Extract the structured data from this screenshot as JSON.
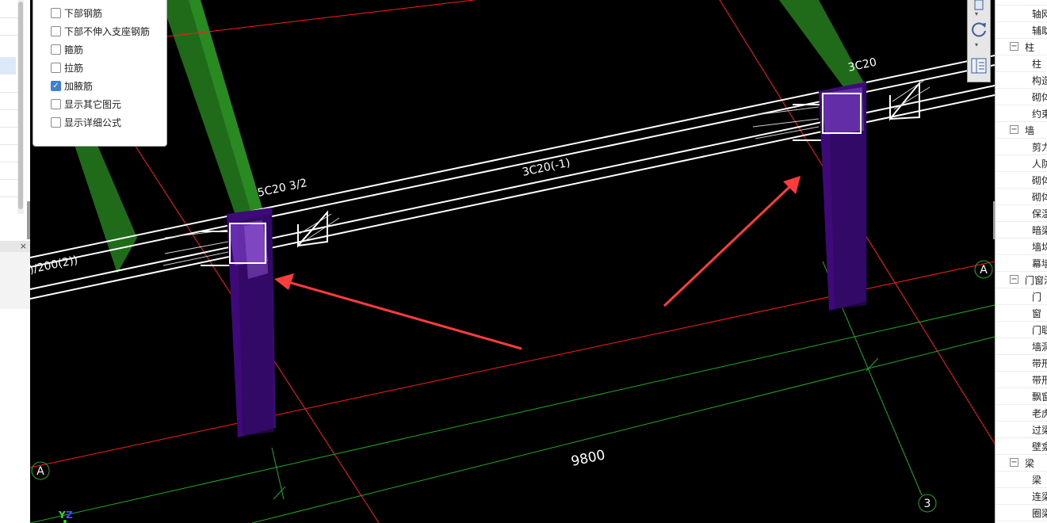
{
  "left_panel": {
    "header_label": "×"
  },
  "popup": {
    "options": [
      {
        "label": "下部钢筋",
        "checked": false
      },
      {
        "label": "下部不伸入支座钢筋",
        "checked": false
      },
      {
        "label": "箍筋",
        "checked": false
      },
      {
        "label": "拉筋",
        "checked": false
      },
      {
        "label": "加腋筋",
        "checked": true
      },
      {
        "label": "显示其它图元",
        "checked": false
      },
      {
        "label": "显示详细公式",
        "checked": false
      }
    ]
  },
  "viewport": {
    "annotations": {
      "beam_left": ")/200(2))",
      "left_column_top": "5C20 3/2",
      "beam_mid": "3C20(-1)",
      "right_column_top": "3C20",
      "dimension": "9800",
      "axis_a_left": "A",
      "axis_a_right": "A",
      "axis_3": "3",
      "coord_y": "Y",
      "coord_z": "Z"
    },
    "colors": {
      "background": "#000000",
      "column": "#3d0a78",
      "column_face": "#5a1eb0",
      "green_beam": "#1f6b1a",
      "red_axis": "#ff1a1a",
      "green_axis": "#1faa1f",
      "arrow": "#ff3b3b"
    }
  },
  "right_panel": {
    "rows": [
      {
        "type": "item",
        "label": "轴网"
      },
      {
        "type": "item",
        "label": "辅助"
      },
      {
        "type": "group",
        "label": "柱",
        "toggle": "−"
      },
      {
        "type": "item",
        "label": "柱"
      },
      {
        "type": "item",
        "label": "构造"
      },
      {
        "type": "item",
        "label": "砌体"
      },
      {
        "type": "item",
        "label": "约束"
      },
      {
        "type": "group",
        "label": "墙",
        "toggle": "−"
      },
      {
        "type": "item",
        "label": "剪力"
      },
      {
        "type": "item",
        "label": "人防"
      },
      {
        "type": "item",
        "label": "砌体"
      },
      {
        "type": "item",
        "label": "砌体"
      },
      {
        "type": "item",
        "label": "保温"
      },
      {
        "type": "item",
        "label": "暗梁"
      },
      {
        "type": "item",
        "label": "墙垛"
      },
      {
        "type": "item",
        "label": "幕墙"
      },
      {
        "type": "group",
        "label": "门窗洞",
        "toggle": "−"
      },
      {
        "type": "item",
        "label": "门"
      },
      {
        "type": "item",
        "label": "窗"
      },
      {
        "type": "item",
        "label": "门联"
      },
      {
        "type": "item",
        "label": "墙洞"
      },
      {
        "type": "item",
        "label": "带形"
      },
      {
        "type": "item",
        "label": "带形"
      },
      {
        "type": "item",
        "label": "飘窗"
      },
      {
        "type": "item",
        "label": "老虎"
      },
      {
        "type": "item",
        "label": "过梁"
      },
      {
        "type": "item",
        "label": "壁龛"
      },
      {
        "type": "group",
        "label": "梁",
        "toggle": "−"
      },
      {
        "type": "item",
        "label": "梁"
      },
      {
        "type": "item",
        "label": "连梁"
      },
      {
        "type": "item",
        "label": "圈梁"
      }
    ]
  },
  "toolbar": {
    "buttons": [
      {
        "icon": "view-cube-icon"
      },
      {
        "icon": "rotate-icon"
      },
      {
        "icon": "panel-toggle-icon"
      }
    ]
  }
}
